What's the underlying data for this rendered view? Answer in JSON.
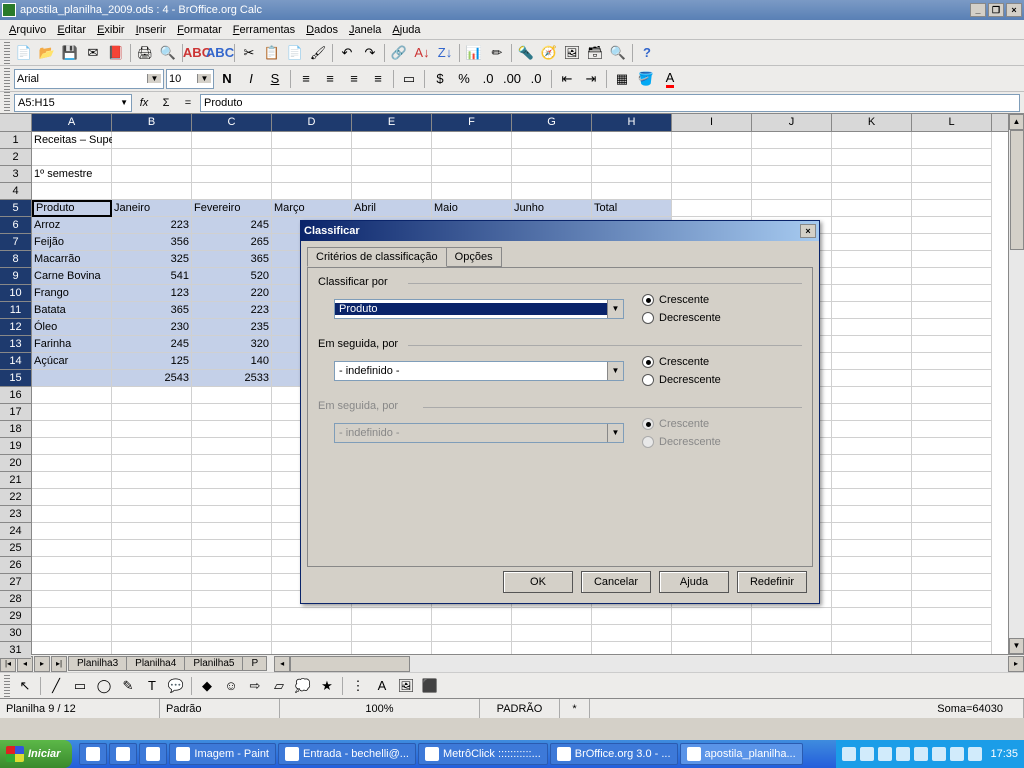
{
  "title": "apostila_planilha_2009.ods : 4 - BrOffice.org Calc",
  "menus": [
    "Arquivo",
    "Editar",
    "Exibir",
    "Inserir",
    "Formatar",
    "Ferramentas",
    "Dados",
    "Janela",
    "Ajuda"
  ],
  "font": {
    "name": "Arial",
    "size": "10"
  },
  "cellref": "A5:H15",
  "fxvalue": "Produto",
  "columns": [
    "A",
    "B",
    "C",
    "D",
    "E",
    "F",
    "G",
    "H",
    "I",
    "J",
    "K",
    "L"
  ],
  "sel_cols": [
    "A",
    "B",
    "C",
    "D",
    "E",
    "F",
    "G",
    "H"
  ],
  "sel_rows": [
    5,
    6,
    7,
    8,
    9,
    10,
    11,
    12,
    13,
    14,
    15
  ],
  "rows_visible": 31,
  "sheet_data": {
    "1": {
      "A": "Receitas – Supermercado"
    },
    "3": {
      "A": "1º semestre"
    },
    "5": {
      "A": "Produto",
      "B": "Janeiro",
      "C": "Fevereiro",
      "D": "Março",
      "E": "Abril",
      "F": "Maio",
      "G": "Junho",
      "H": "Total"
    },
    "6": {
      "A": "Arroz",
      "B": "223",
      "C": "245"
    },
    "7": {
      "A": "Feijão",
      "B": "356",
      "C": "265"
    },
    "8": {
      "A": "Macarrão",
      "B": "325",
      "C": "365"
    },
    "9": {
      "A": "Carne Bovina",
      "B": "541",
      "C": "520"
    },
    "10": {
      "A": "Frango",
      "B": "123",
      "C": "220"
    },
    "11": {
      "A": "Batata",
      "B": "365",
      "C": "223"
    },
    "12": {
      "A": "Óleo",
      "B": "230",
      "C": "235"
    },
    "13": {
      "A": "Farinha",
      "B": "245",
      "C": "320"
    },
    "14": {
      "A": "Açúcar",
      "B": "125",
      "C": "140"
    },
    "15": {
      "B": "2543",
      "C": "2533"
    }
  },
  "tabs": [
    "Planilha3",
    "Planilha4",
    "Planilha5",
    "P"
  ],
  "status": {
    "sheet": "Planilha 9 / 12",
    "style": "Padrão",
    "zoom": "100%",
    "std": "PADRÃO",
    "mod": "*",
    "sum": "Soma=64030"
  },
  "dialog": {
    "title": "Classificar",
    "tabs": [
      "Critérios de classificação",
      "Opções"
    ],
    "group1": {
      "label": "Classificar por",
      "value": "Produto",
      "asc": "Crescente",
      "desc": "Decrescente"
    },
    "group2": {
      "label": "Em seguida, por",
      "value": "- indefinido -",
      "asc": "Crescente",
      "desc": "Decrescente"
    },
    "group3": {
      "label": "Em seguida, por",
      "value": "- indefinido -",
      "asc": "Crescente",
      "desc": "Decrescente"
    },
    "buttons": {
      "ok": "OK",
      "cancel": "Cancelar",
      "help": "Ajuda",
      "reset": "Redefinir"
    }
  },
  "taskbar": {
    "start": "Iniciar",
    "items": [
      "Imagem - Paint",
      "Entrada - bechelli@...",
      "MetrôClick :::::::::::...",
      "BrOffice.org 3.0 - ...",
      "apostila_planilha..."
    ],
    "time": "17:35"
  }
}
